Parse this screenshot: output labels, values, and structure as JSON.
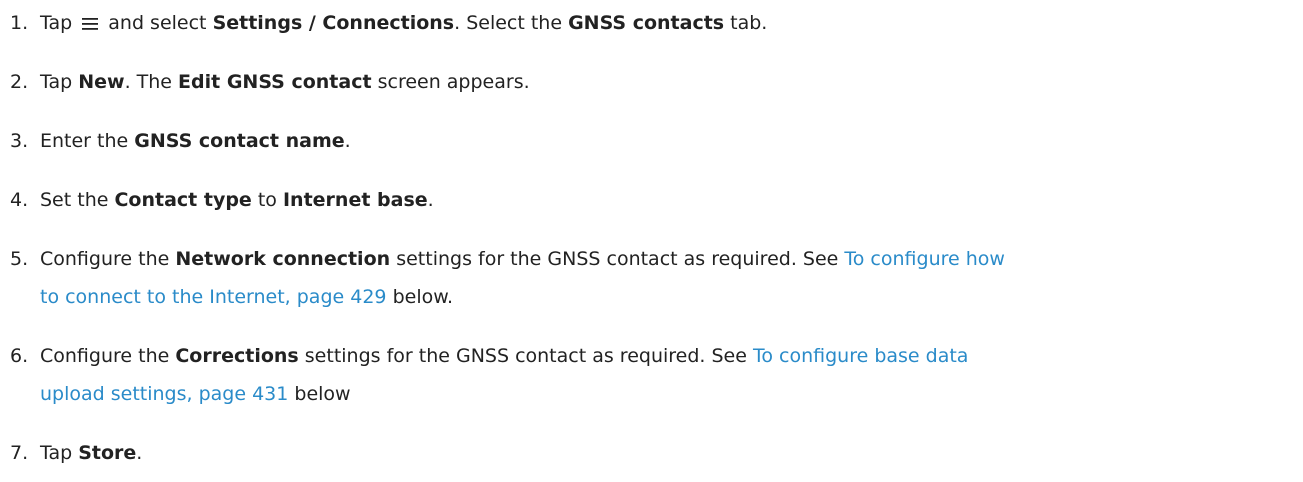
{
  "steps": [
    {
      "number": "1.",
      "parts": {
        "a": "Tap",
        "b": "and select",
        "c": "Settings / Connections",
        "d": ". Select the",
        "e": "GNSS contacts",
        "f": "tab."
      },
      "icon": "hamburger-menu-icon"
    },
    {
      "number": "2.",
      "parts": {
        "a": "Tap",
        "b": "New",
        "c": ". The",
        "d": "Edit GNSS contact",
        "e": "screen appears."
      }
    },
    {
      "number": "3.",
      "parts": {
        "a": "Enter the",
        "b": "GNSS contact name",
        "c": "."
      }
    },
    {
      "number": "4.",
      "parts": {
        "a": "Set the",
        "b": "Contact type",
        "c": "to",
        "d": "Internet base",
        "e": "."
      }
    },
    {
      "number": "5.",
      "parts": {
        "a": "Configure the",
        "b": "Network connection",
        "c": "settings for the GNSS contact as required. See",
        "link_line1": "To configure how",
        "link_line2": "to connect to the Internet, page 429",
        "d": "below."
      }
    },
    {
      "number": "6.",
      "parts": {
        "a": "Configure the",
        "b": "Corrections",
        "c": "settings for the GNSS contact as required. See",
        "link_line1": "To configure base data",
        "link_line2": "upload settings, page 431",
        "d": "below"
      }
    },
    {
      "number": "7.",
      "parts": {
        "a": "Tap",
        "b": "Store",
        "c": "."
      }
    }
  ],
  "colors": {
    "text": "#222222",
    "link": "#2a8bc9"
  }
}
